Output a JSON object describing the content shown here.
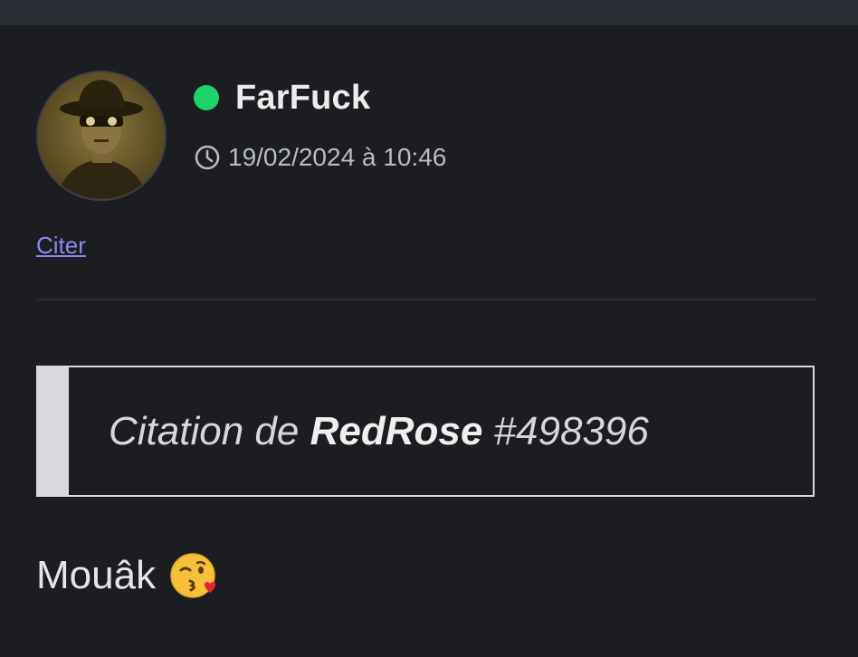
{
  "post": {
    "author": {
      "name": "FarFuck",
      "status": "online",
      "status_color": "#1fd36b"
    },
    "timestamp": "19/02/2024 à 10:46",
    "actions": {
      "quote_label": "Citer"
    },
    "blockquote": {
      "prefix": "Citation de",
      "quoted_user": "RedRose",
      "reference": "#498396"
    },
    "message": {
      "text": "Mouâk",
      "emoji": "face-blowing-a-kiss"
    }
  },
  "colors": {
    "background": "#1b1d21",
    "link": "#8f86ea",
    "online": "#1fd36b",
    "quote_border": "#d8dadd"
  }
}
